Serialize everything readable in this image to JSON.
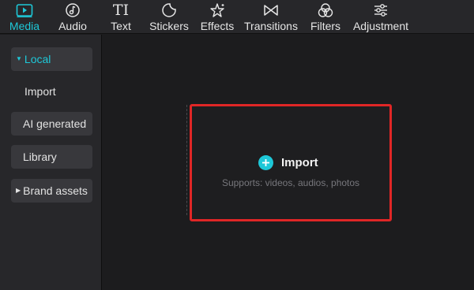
{
  "toolbar": {
    "tabs": [
      {
        "label": "Media",
        "icon": "play-square-icon",
        "active": true
      },
      {
        "label": "Audio",
        "icon": "music-note-icon"
      },
      {
        "label": "Text",
        "icon": "text-ti-icon"
      },
      {
        "label": "Stickers",
        "icon": "sticker-icon"
      },
      {
        "label": "Effects",
        "icon": "sparkle-star-icon"
      },
      {
        "label": "Transitions",
        "icon": "bowtie-icon"
      },
      {
        "label": "Filters",
        "icon": "circles-icon"
      },
      {
        "label": "Adjustment",
        "icon": "sliders-icon"
      }
    ],
    "active_color": "#1ec8d8"
  },
  "sidebar": {
    "local": "Local",
    "import": "Import",
    "ai_generated": "AI generated",
    "library": "Library",
    "brand_assets": "Brand assets"
  },
  "main": {
    "import_label": "Import",
    "supports_text": "Supports: videos, audios, photos",
    "highlight_color": "#e02626"
  },
  "icon_glyphs": {
    "text": "TI"
  }
}
